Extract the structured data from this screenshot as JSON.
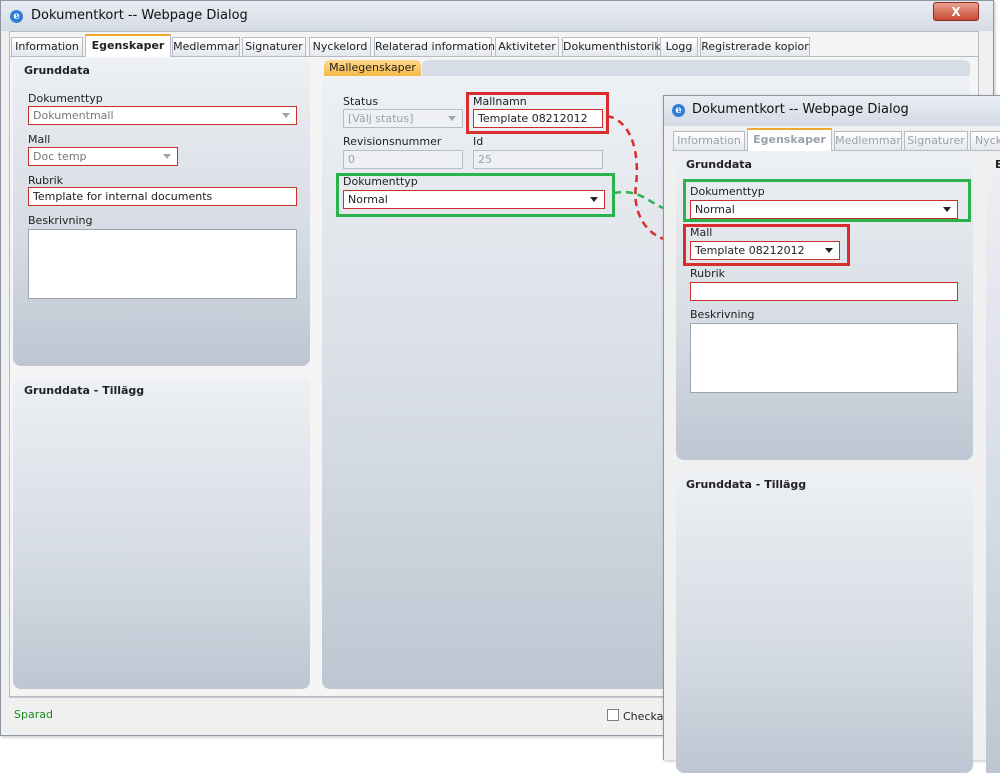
{
  "main_window": {
    "title": "Dokumentkort -- Webpage Dialog",
    "close_label": "X",
    "tabs": [
      {
        "label": "Information"
      },
      {
        "label": "Egenskaper"
      },
      {
        "label": "Medlemmar"
      },
      {
        "label": "Signaturer"
      },
      {
        "label": "Nyckelord"
      },
      {
        "label": "Relaterad information"
      },
      {
        "label": "Aktiviteter"
      },
      {
        "label": "Dokumenthistorik"
      },
      {
        "label": "Logg"
      },
      {
        "label": "Registrerade kopior"
      }
    ],
    "grunddata": {
      "title": "Grunddata",
      "dokumenttyp_label": "Dokumenttyp",
      "dokumenttyp_value": "Dokumentmall",
      "mall_label": "Mall",
      "mall_value": "Doc temp",
      "rubrik_label": "Rubrik",
      "rubrik_value": "Template for internal documents",
      "beskrivning_label": "Beskrivning"
    },
    "tillagg": {
      "title": "Grunddata - Tillägg"
    },
    "mallegenskaper": {
      "tab_label": "Mallegenskaper",
      "status_label": "Status",
      "status_value": "[Välj status]",
      "mallnamn_label": "Mallnamn",
      "mallnamn_value": "Template 08212012",
      "revisionsnummer_label": "Revisionsnummer",
      "revisionsnummer_value": "0",
      "id_label": "Id",
      "id_value": "25",
      "dokumenttyp_label": "Dokumenttyp",
      "dokumenttyp_value": "Normal"
    },
    "footer": {
      "status_text": "Sparad",
      "checkbox_label": "Checka u"
    }
  },
  "overlay_window": {
    "title": "Dokumentkort -- Webpage Dialog",
    "tabs": [
      {
        "label": "Information"
      },
      {
        "label": "Egenskaper"
      },
      {
        "label": "Medlemmar"
      },
      {
        "label": "Signaturer"
      },
      {
        "label": "Nyck"
      }
    ],
    "grunddata": {
      "title": "Grunddata",
      "dokumenttyp_label": "Dokumenttyp",
      "dokumenttyp_value": "Normal",
      "mall_label": "Mall",
      "mall_value": "Template 08212012",
      "rubrik_label": "Rubrik",
      "rubrik_value": "",
      "beskrivning_label": "Beskrivning"
    },
    "tillagg": {
      "title": "Grunddata - Tillägg"
    },
    "side_letter": "E"
  },
  "colors": {
    "highlight_red": "#d92d2d",
    "highlight_green": "#2bb24c",
    "active_tab_accent": "#f0a830",
    "status_green": "#1f8a1f"
  }
}
